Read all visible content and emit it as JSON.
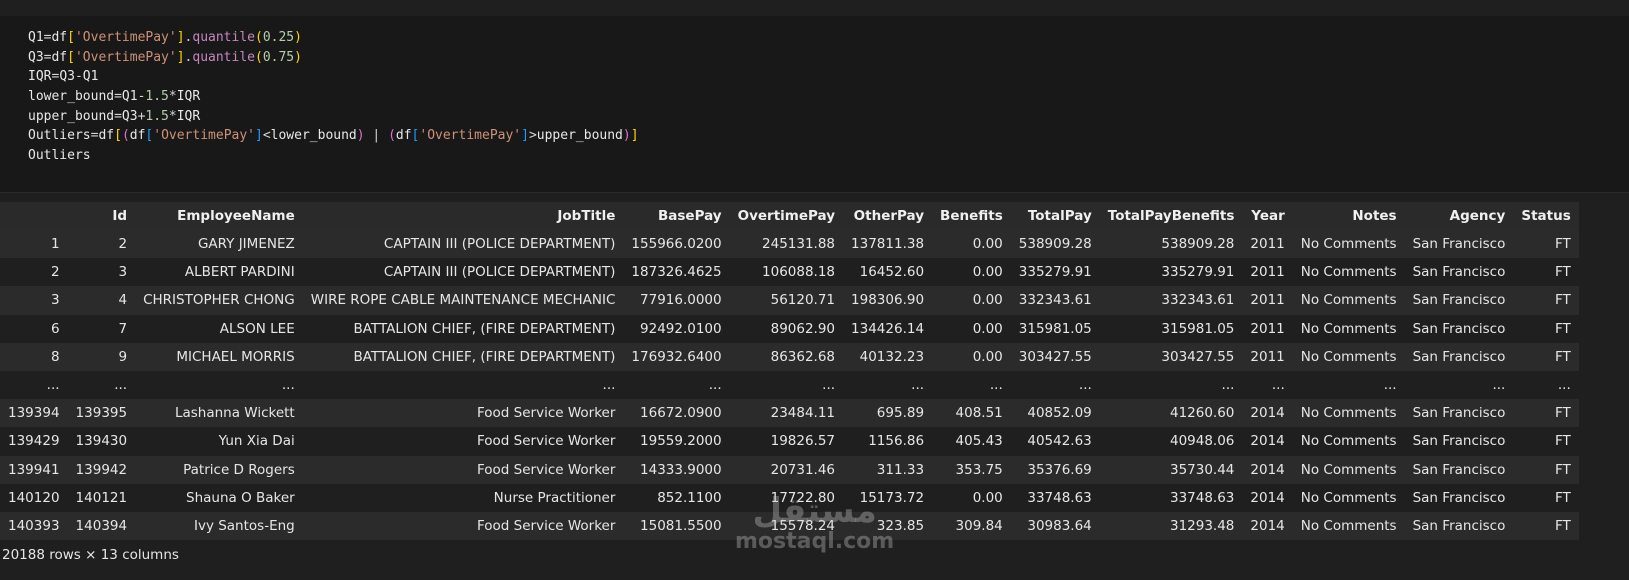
{
  "code": {
    "lines": [
      [
        [
          "Q1",
          "var"
        ],
        [
          "=",
          "op"
        ],
        [
          "df",
          "var"
        ],
        [
          "[",
          "br1"
        ],
        [
          "'OvertimePay'",
          "str"
        ],
        [
          "]",
          "br1"
        ],
        [
          ".",
          "op"
        ],
        [
          "quantile",
          "fn"
        ],
        [
          "(",
          "br1"
        ],
        [
          "0.25",
          "num"
        ],
        [
          ")",
          "br1"
        ]
      ],
      [
        [
          "Q3",
          "var"
        ],
        [
          "=",
          "op"
        ],
        [
          "df",
          "var"
        ],
        [
          "[",
          "br1"
        ],
        [
          "'OvertimePay'",
          "str"
        ],
        [
          "]",
          "br1"
        ],
        [
          ".",
          "op"
        ],
        [
          "quantile",
          "fn"
        ],
        [
          "(",
          "br1"
        ],
        [
          "0.75",
          "num"
        ],
        [
          ")",
          "br1"
        ]
      ],
      [
        [
          "IQR",
          "var"
        ],
        [
          "=",
          "op"
        ],
        [
          "Q3",
          "var"
        ],
        [
          "-",
          "op"
        ],
        [
          "Q1",
          "var"
        ]
      ],
      [
        [
          "lower_bound",
          "var"
        ],
        [
          "=",
          "op"
        ],
        [
          "Q1",
          "var"
        ],
        [
          "-",
          "op"
        ],
        [
          "1.5",
          "num"
        ],
        [
          "*",
          "op"
        ],
        [
          "IQR",
          "var"
        ]
      ],
      [
        [
          "upper_bound",
          "var"
        ],
        [
          "=",
          "op"
        ],
        [
          "Q3",
          "var"
        ],
        [
          "+",
          "op"
        ],
        [
          "1.5",
          "num"
        ],
        [
          "*",
          "op"
        ],
        [
          "IQR",
          "var"
        ]
      ],
      [
        [
          "Outliers",
          "var"
        ],
        [
          "=",
          "op"
        ],
        [
          "df",
          "var"
        ],
        [
          "[",
          "br1"
        ],
        [
          "(",
          "br2"
        ],
        [
          "df",
          "var"
        ],
        [
          "[",
          "br3"
        ],
        [
          "'OvertimePay'",
          "str"
        ],
        [
          "]",
          "br3"
        ],
        [
          "<",
          "op"
        ],
        [
          "lower_bound",
          "var"
        ],
        [
          ")",
          "br2"
        ],
        [
          " | ",
          "op"
        ],
        [
          "(",
          "br2"
        ],
        [
          "df",
          "var"
        ],
        [
          "[",
          "br3"
        ],
        [
          "'OvertimePay'",
          "str"
        ],
        [
          "]",
          "br3"
        ],
        [
          ">",
          "op"
        ],
        [
          "upper_bound",
          "var"
        ],
        [
          ")",
          "br2"
        ],
        [
          "]",
          "br1"
        ]
      ],
      [
        [
          "Outliers",
          "var"
        ]
      ]
    ]
  },
  "table": {
    "columns": [
      "",
      "Id",
      "EmployeeName",
      "JobTitle",
      "BasePay",
      "OvertimePay",
      "OtherPay",
      "Benefits",
      "TotalPay",
      "TotalPayBenefits",
      "Year",
      "Notes",
      "Agency",
      "Status"
    ],
    "rows": [
      [
        "1",
        "2",
        "GARY JIMENEZ",
        "CAPTAIN III (POLICE DEPARTMENT)",
        "155966.0200",
        "245131.88",
        "137811.38",
        "0.00",
        "538909.28",
        "538909.28",
        "2011",
        "No Comments",
        "San Francisco",
        "FT"
      ],
      [
        "2",
        "3",
        "ALBERT PARDINI",
        "CAPTAIN III (POLICE DEPARTMENT)",
        "187326.4625",
        "106088.18",
        "16452.60",
        "0.00",
        "335279.91",
        "335279.91",
        "2011",
        "No Comments",
        "San Francisco",
        "FT"
      ],
      [
        "3",
        "4",
        "CHRISTOPHER CHONG",
        "WIRE ROPE CABLE MAINTENANCE MECHANIC",
        "77916.0000",
        "56120.71",
        "198306.90",
        "0.00",
        "332343.61",
        "332343.61",
        "2011",
        "No Comments",
        "San Francisco",
        "FT"
      ],
      [
        "6",
        "7",
        "ALSON LEE",
        "BATTALION CHIEF, (FIRE DEPARTMENT)",
        "92492.0100",
        "89062.90",
        "134426.14",
        "0.00",
        "315981.05",
        "315981.05",
        "2011",
        "No Comments",
        "San Francisco",
        "FT"
      ],
      [
        "8",
        "9",
        "MICHAEL MORRIS",
        "BATTALION CHIEF, (FIRE DEPARTMENT)",
        "176932.6400",
        "86362.68",
        "40132.23",
        "0.00",
        "303427.55",
        "303427.55",
        "2011",
        "No Comments",
        "San Francisco",
        "FT"
      ],
      [
        "...",
        "...",
        "...",
        "...",
        "...",
        "...",
        "...",
        "...",
        "...",
        "...",
        "...",
        "...",
        "...",
        "..."
      ],
      [
        "139394",
        "139395",
        "Lashanna Wickett",
        "Food Service Worker",
        "16672.0900",
        "23484.11",
        "695.89",
        "408.51",
        "40852.09",
        "41260.60",
        "2014",
        "No Comments",
        "San Francisco",
        "FT"
      ],
      [
        "139429",
        "139430",
        "Yun Xia Dai",
        "Food Service Worker",
        "19559.2000",
        "19826.57",
        "1156.86",
        "405.43",
        "40542.63",
        "40948.06",
        "2014",
        "No Comments",
        "San Francisco",
        "FT"
      ],
      [
        "139941",
        "139942",
        "Patrice D Rogers",
        "Food Service Worker",
        "14333.9000",
        "20731.46",
        "311.33",
        "353.75",
        "35376.69",
        "35730.44",
        "2014",
        "No Comments",
        "San Francisco",
        "FT"
      ],
      [
        "140120",
        "140121",
        "Shauna O Baker",
        "Nurse Practitioner",
        "852.1100",
        "17722.80",
        "15173.72",
        "0.00",
        "33748.63",
        "33748.63",
        "2014",
        "No Comments",
        "San Francisco",
        "FT"
      ],
      [
        "140393",
        "140394",
        "Ivy Santos-Eng",
        "Food Service Worker",
        "15081.5500",
        "15578.24",
        "323.85",
        "309.84",
        "30983.64",
        "31293.48",
        "2014",
        "No Comments",
        "San Francisco",
        "FT"
      ]
    ]
  },
  "summary": "20188 rows × 13 columns",
  "watermark": {
    "arabic": "مستقل",
    "latin": "mostaql.com"
  }
}
